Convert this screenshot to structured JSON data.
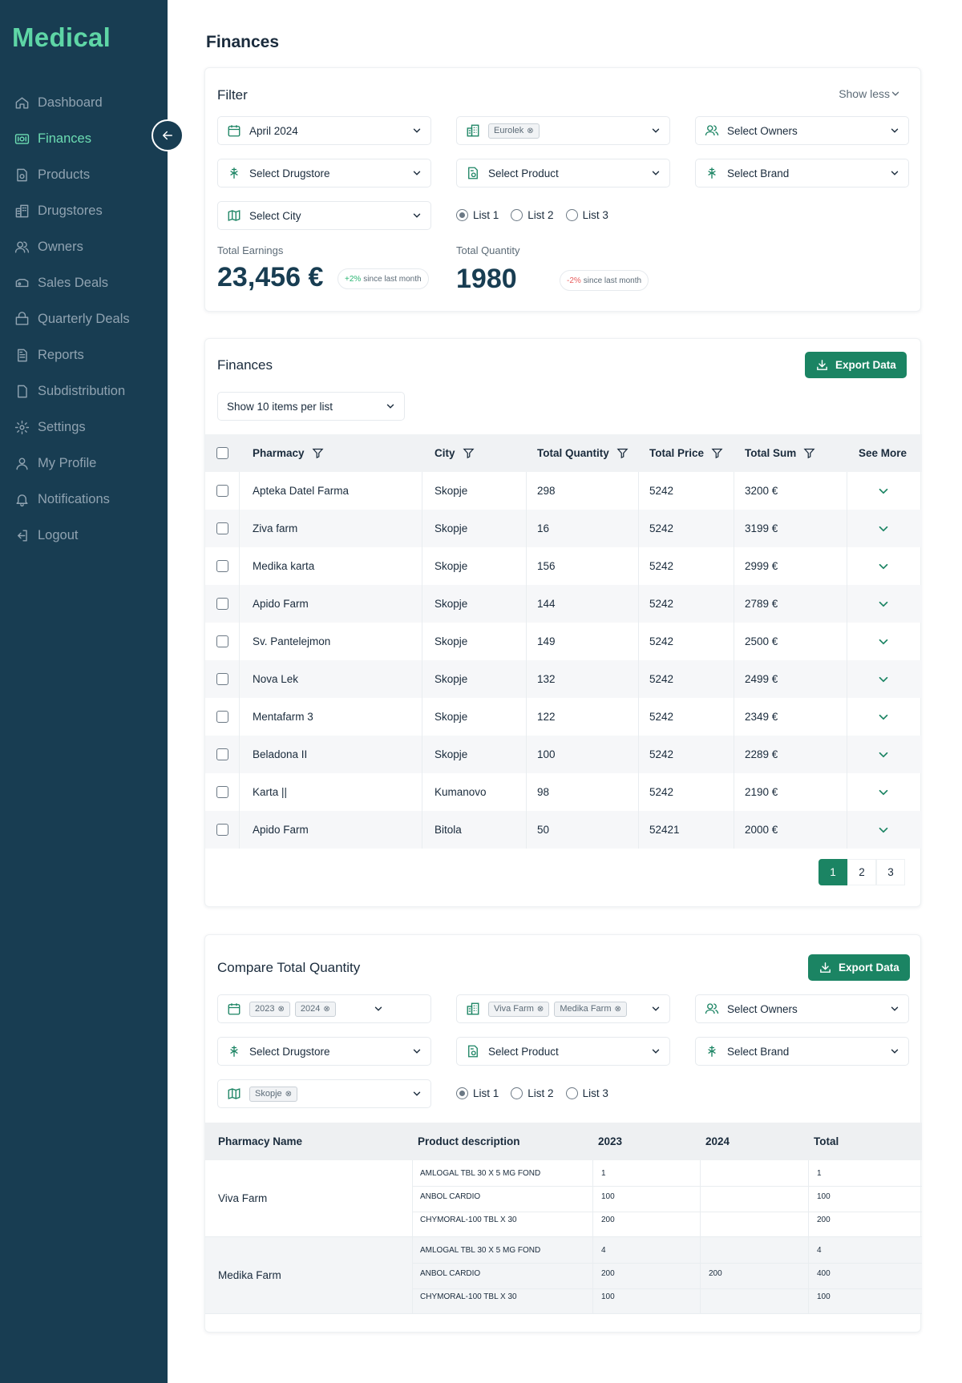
{
  "app": {
    "name": "Medical"
  },
  "nav": {
    "items": [
      {
        "label": "Dashboard",
        "icon": "home-icon"
      },
      {
        "label": "Finances",
        "icon": "finances-icon",
        "active": true
      },
      {
        "label": "Products",
        "icon": "products-icon"
      },
      {
        "label": "Drugstores",
        "icon": "drugstores-icon"
      },
      {
        "label": "Owners",
        "icon": "owners-icon"
      },
      {
        "label": "Sales Deals",
        "icon": "sales-deals-icon"
      },
      {
        "label": "Quarterly Deals",
        "icon": "quarterly-deals-icon"
      },
      {
        "label": "Reports",
        "icon": "reports-icon"
      },
      {
        "label": "Subdistribution",
        "icon": "subdistribution-icon"
      },
      {
        "label": "Settings",
        "icon": "gear-icon"
      },
      {
        "label": "My Profile",
        "icon": "user-icon"
      },
      {
        "label": "Notifications",
        "icon": "bell-icon"
      },
      {
        "label": "Logout",
        "icon": "logout-icon"
      }
    ]
  },
  "page": {
    "title": "Finances"
  },
  "filter": {
    "title": "Filter",
    "toggle_label": "Show less",
    "date": "April 2024",
    "drugstore_chips": [
      "Eurolek"
    ],
    "owners": "Select Owners",
    "drugstore": "Select Drugstore",
    "product": "Select Product",
    "brand": "Select Brand",
    "city": "Select City",
    "lists": [
      "List 1",
      "List 2",
      "List 3"
    ],
    "selected_list": "List 1",
    "total_earnings_label": "Total Earnings",
    "total_earnings": "23,456 €",
    "earnings_change": "+2%",
    "earnings_change_suffix": "since last month",
    "total_quantity_label": "Total Quantity",
    "total_quantity": "1980",
    "quantity_change": "-2%",
    "quantity_change_suffix": "since last month"
  },
  "finances": {
    "title": "Finances",
    "export_label": "Export Data",
    "per_page": "Show 10 items per list",
    "columns": [
      "Pharmacy",
      "City",
      "Total Quantity",
      "Total Price",
      "Total Sum",
      "See More"
    ],
    "rows": [
      {
        "pharmacy": "Apteka Datel Farma",
        "city": "Skopje",
        "qty": "298",
        "price": "5242",
        "sum": "3200 €"
      },
      {
        "pharmacy": "Ziva farm",
        "city": "Skopje",
        "qty": "16",
        "price": "5242",
        "sum": "3199 €"
      },
      {
        "pharmacy": "Medika karta",
        "city": "Skopje",
        "qty": "156",
        "price": "5242",
        "sum": "2999 €"
      },
      {
        "pharmacy": "Apido Farm",
        "city": "Skopje",
        "qty": "144",
        "price": "5242",
        "sum": "2789 €"
      },
      {
        "pharmacy": "Sv. Pantelejmon",
        "city": "Skopje",
        "qty": "149",
        "price": "5242",
        "sum": "2500 €"
      },
      {
        "pharmacy": "Nova Lek",
        "city": "Skopje",
        "qty": "132",
        "price": "5242",
        "sum": "2499 €"
      },
      {
        "pharmacy": "Mentafarm 3",
        "city": "Skopje",
        "qty": "122",
        "price": "5242",
        "sum": "2349 €"
      },
      {
        "pharmacy": "Beladona II",
        "city": "Skopje",
        "qty": "100",
        "price": "5242",
        "sum": "2289 €"
      },
      {
        "pharmacy": "Karta ||",
        "city": "Kumanovo",
        "qty": "98",
        "price": "5242",
        "sum": "2190 €"
      },
      {
        "pharmacy": "Apido Farm",
        "city": "Bitola",
        "qty": "50",
        "price": "52421",
        "sum": "2000 €"
      }
    ],
    "pages": [
      "1",
      "2",
      "3"
    ],
    "current_page": "1"
  },
  "compare": {
    "title": "Compare Total Quantity",
    "export_label": "Export Data",
    "year_chips": [
      "2023",
      "2024"
    ],
    "pharmacy_chips": [
      "Viva Farm",
      "Medika Farm"
    ],
    "owners": "Select Owners",
    "drugstore": "Select Drugstore",
    "product": "Select Product",
    "brand": "Select Brand",
    "city_chips": [
      "Skopje"
    ],
    "lists": [
      "List 1",
      "List 2",
      "List 3"
    ],
    "selected_list": "List 1",
    "columns": [
      "Pharmacy Name",
      "Product description",
      "2023",
      "2024",
      "Total"
    ],
    "groups": [
      {
        "pharmacy": "Viva Farm",
        "items": [
          {
            "product": "AMLOGAL TBL 30 X 5 MG FOND",
            "y2023": "1",
            "y2024": "",
            "total": "1"
          },
          {
            "product": "ANBOL CARDIO",
            "y2023": "100",
            "y2024": "",
            "total": "100"
          },
          {
            "product": "CHYMORAL-100 TBL X 30",
            "y2023": "200",
            "y2024": "",
            "total": "200"
          }
        ]
      },
      {
        "pharmacy": "Medika Farm",
        "items": [
          {
            "product": "AMLOGAL TBL 30 X 5 MG FOND",
            "y2023": "4",
            "y2024": "",
            "total": "4"
          },
          {
            "product": "ANBOL CARDIO",
            "y2023": "200",
            "y2024": "200",
            "total": "400"
          },
          {
            "product": "CHYMORAL-100 TBL X 30",
            "y2023": "100",
            "y2024": "",
            "total": "100"
          }
        ]
      }
    ]
  },
  "colors": {
    "sidebar": "#183d52",
    "accent": "#1b8463",
    "logo": "#5ed6a6",
    "active_nav": "#6cdcb2"
  }
}
